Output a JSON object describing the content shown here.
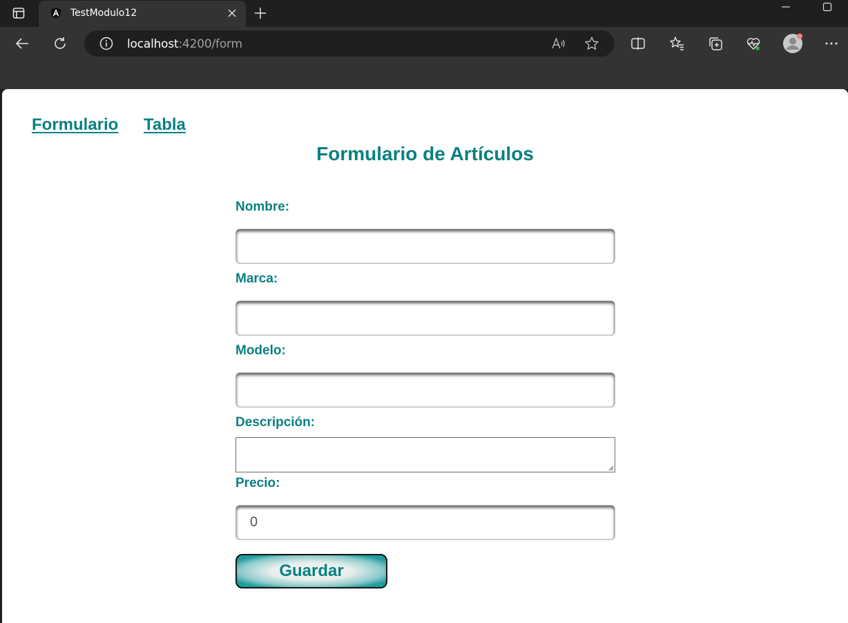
{
  "browser": {
    "tab_title": "TestModulo12",
    "url_host": "localhost",
    "url_path": ":4200/form"
  },
  "nav": {
    "links": [
      {
        "label": "Formulario"
      },
      {
        "label": "Tabla"
      }
    ]
  },
  "page": {
    "title": "Formulario de Artículos"
  },
  "form": {
    "fields": [
      {
        "label": "Nombre:",
        "value": ""
      },
      {
        "label": "Marca:",
        "value": ""
      },
      {
        "label": "Modelo:",
        "value": ""
      },
      {
        "label": "Descripción:",
        "value": ""
      },
      {
        "label": "Precio:",
        "value": "0"
      }
    ],
    "submit_label": "Guardar"
  },
  "colors": {
    "accent": "#0b8080",
    "chrome_dark": "#1f1f1f",
    "chrome_toolbar": "#333333"
  },
  "icons": {
    "tab_actions": "tab-actions-icon",
    "favicon": "angular-logo-icon",
    "close": "close-icon",
    "new_tab": "plus-icon",
    "back": "back-arrow-icon",
    "refresh": "refresh-icon",
    "info": "info-icon",
    "read_aloud": "read-aloud-icon",
    "favorite": "star-icon",
    "split_screen": "split-screen-icon",
    "favorites": "favorites-icon",
    "collections": "collections-icon",
    "performance": "heartbeat-icon",
    "profile": "profile-avatar-icon",
    "more": "more-dots-icon"
  }
}
